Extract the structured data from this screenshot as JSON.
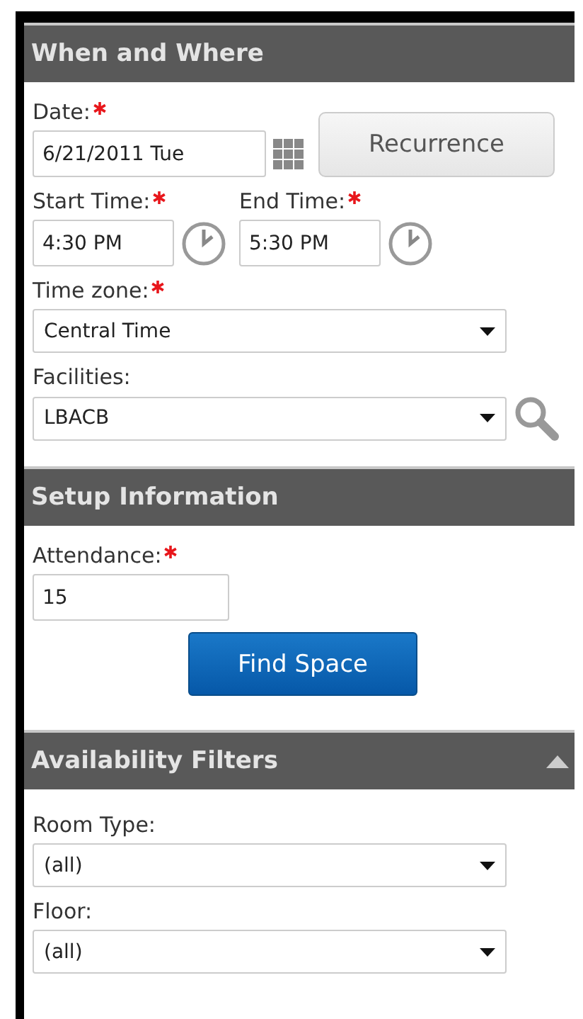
{
  "sections": [
    {
      "title": "When and Where",
      "fields": [
        {
          "kind": "date",
          "label": "Date:",
          "required": true,
          "value": "6/21/2011 Tue",
          "button": "Recurrence"
        },
        {
          "kind": "times",
          "items": [
            {
              "label": "Start Time:",
              "required": true,
              "value": "4:30 PM"
            },
            {
              "label": "End Time:",
              "required": true,
              "value": "5:30 PM"
            }
          ]
        },
        {
          "kind": "select",
          "label": "Time zone:",
          "required": true,
          "value": "Central Time",
          "search": false
        },
        {
          "kind": "select",
          "label": "Facilities:",
          "required": false,
          "value": "LBACB",
          "search": true
        }
      ]
    },
    {
      "title": "Setup Information",
      "fields": [
        {
          "kind": "text",
          "label": "Attendance:",
          "required": true,
          "value": "15"
        },
        {
          "kind": "button",
          "label": "Find Space"
        }
      ]
    },
    {
      "title": "Availability Filters",
      "expanded": true,
      "fields": [
        {
          "kind": "select",
          "label": "Room Type:",
          "required": false,
          "value": "(all)",
          "search": false
        },
        {
          "kind": "select",
          "label": "Floor:",
          "required": false,
          "value": "(all)",
          "search": false
        }
      ]
    }
  ]
}
